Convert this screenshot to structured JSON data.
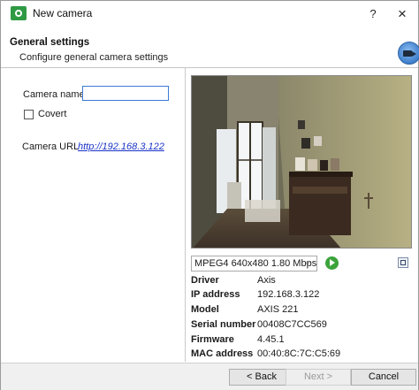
{
  "window": {
    "title": "New camera",
    "help_glyph": "?",
    "close_glyph": "×"
  },
  "header": {
    "title": "General settings",
    "subtitle": "Configure general camera settings"
  },
  "form": {
    "camera_name_label": "Camera name",
    "camera_name_value": "",
    "covert_label": "Covert",
    "covert_checked": false,
    "camera_url_label": "Camera URL",
    "camera_url_link": "http://192.168.3.122"
  },
  "stream": {
    "selected": "MPEG4 640x480 1.80 Mbps"
  },
  "info": [
    {
      "key": "Driver",
      "value": "Axis"
    },
    {
      "key": "IP address",
      "value": "192.168.3.122"
    },
    {
      "key": "Model",
      "value": "AXIS 221"
    },
    {
      "key": "Serial number",
      "value": "00408C7CC569"
    },
    {
      "key": "Firmware",
      "value": "4.45.1"
    },
    {
      "key": "MAC address",
      "value": "00:40:8C:7C:C5:69"
    }
  ],
  "buttons": {
    "back": "< Back",
    "next": "Next >",
    "cancel": "Cancel"
  },
  "colors": {
    "accent_green": "#3ca33b",
    "link": "#1a33c7",
    "focus_border": "#3b7bd2"
  }
}
